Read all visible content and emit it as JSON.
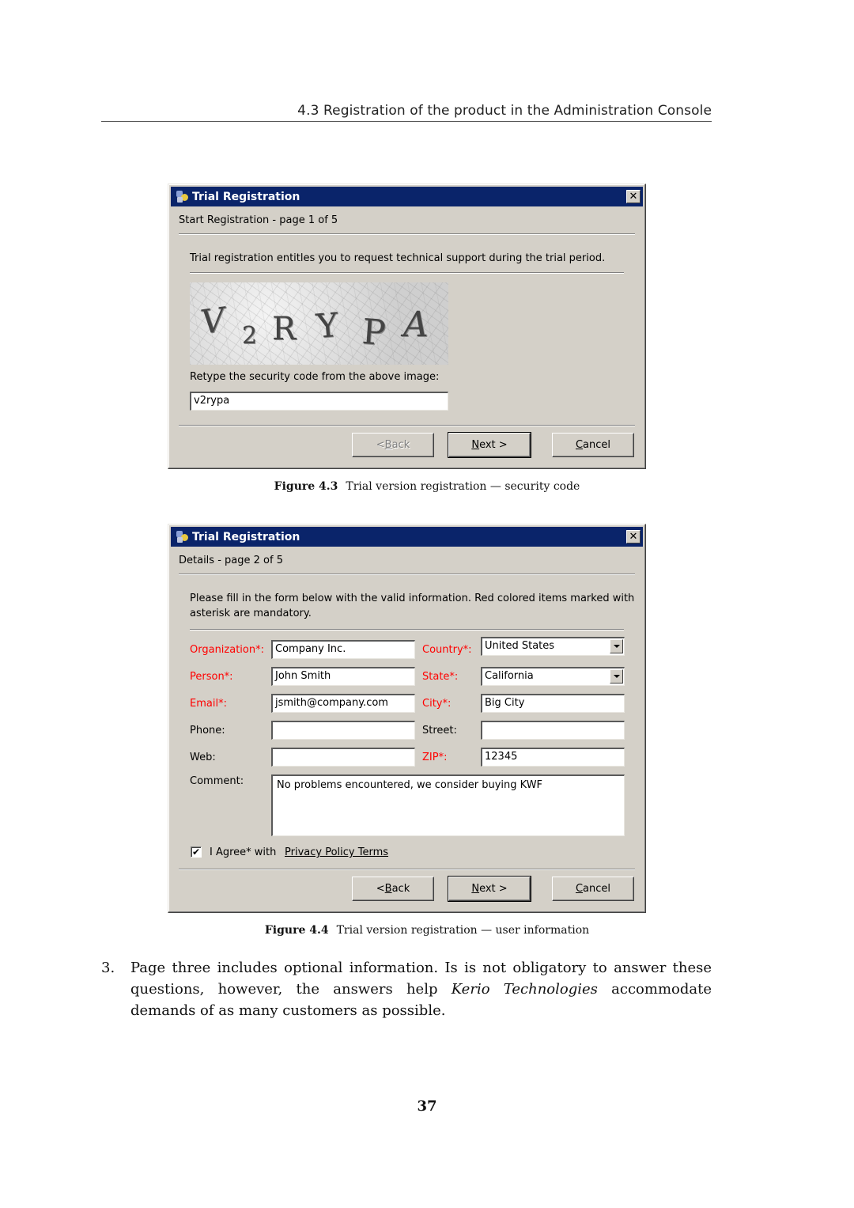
{
  "running_head": "4.3  Registration of the product in the Administration Console",
  "dialog1": {
    "title": "Trial Registration",
    "close_glyph": "✕",
    "page_heading": "Start Registration - page 1 of 5",
    "intro": "Trial registration entitles you to request technical support during the trial period.",
    "captcha_chars": [
      "V",
      "2",
      "R",
      "Y",
      "P",
      "A"
    ],
    "retype_label": "Retype the security code from the above image:",
    "security_code_value": "v2rypa",
    "buttons": {
      "back": {
        "prefix": "< ",
        "mnemonic": "B",
        "rest": "ack",
        "enabled": false
      },
      "next": {
        "prefix": "",
        "mnemonic": "N",
        "rest": "ext >",
        "enabled": true
      },
      "cancel": {
        "prefix": "",
        "mnemonic": "C",
        "rest": "ancel",
        "enabled": true
      }
    }
  },
  "caption1": {
    "label": "Figure 4.3",
    "text": "Trial version registration — security code"
  },
  "dialog2": {
    "title": "Trial Registration",
    "close_glyph": "✕",
    "page_heading": "Details - page 2 of 5",
    "intro_line1": "Please fill in the form below with the valid information. Red colored items marked with",
    "intro_line2": "asterisk are mandatory.",
    "required_color": "#ff0000",
    "left_fields": [
      {
        "label": "Organization*:",
        "value": "Company Inc.",
        "required": true
      },
      {
        "label": "Person*:",
        "value": "John Smith",
        "required": true
      },
      {
        "label": "Email*:",
        "value": "jsmith@company.com",
        "required": true
      },
      {
        "label": "Phone:",
        "value": "",
        "required": false
      },
      {
        "label": "Web:",
        "value": "",
        "required": false
      }
    ],
    "right_fields": [
      {
        "label": "Country*:",
        "value": "United States",
        "required": true,
        "type": "select"
      },
      {
        "label": "State*:",
        "value": "California",
        "required": true,
        "type": "select"
      },
      {
        "label": "City*:",
        "value": "Big City",
        "required": true,
        "type": "text"
      },
      {
        "label": "Street:",
        "value": "",
        "required": false,
        "type": "text"
      },
      {
        "label": "ZIP*:",
        "value": "12345",
        "required": true,
        "type": "text"
      }
    ],
    "comment_label": "Comment:",
    "comment_value": "No problems encountered, we consider buying KWF",
    "agree_checked": true,
    "agree_check_glyph": "✔",
    "agree_label": "I Agree* with",
    "privacy_link": "Privacy Policy Terms",
    "buttons": {
      "back": {
        "prefix": "< ",
        "mnemonic": "B",
        "rest": "ack",
        "enabled": true
      },
      "next": {
        "prefix": "",
        "mnemonic": "N",
        "rest": "ext >",
        "enabled": true
      },
      "cancel": {
        "prefix": "",
        "mnemonic": "C",
        "rest": "ancel",
        "enabled": true
      }
    }
  },
  "caption2": {
    "label": "Figure 4.4",
    "text": "Trial version registration — user information"
  },
  "paragraph": {
    "number": "3.",
    "before_italic": "Page three includes optional information. Is is not obligatory to answer these questions, however, the answers help ",
    "italic": "Kerio Technologies",
    "after_italic": " accommodate demands of as many customers as possible."
  },
  "page_number": "37"
}
